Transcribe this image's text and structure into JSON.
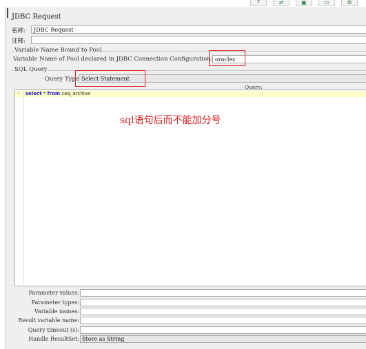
{
  "title": "JDBC Request",
  "name": {
    "label": "名称:",
    "value": "JDBC Request"
  },
  "comments": {
    "label": "注释:",
    "value": ""
  },
  "pool_group": {
    "legend": "Variable Name Bound to Pool",
    "pool_label": "Variable Name of Pool declared in JDBC Connection Configuration:",
    "pool_value": "oraclez"
  },
  "sql_group": {
    "legend": "SQL Query",
    "query_type_label": "Query Type:",
    "query_type_value": "Select Statement",
    "query_header": "Query:",
    "line_number": "1",
    "code_keyword_select": "select",
    "code_star": "*",
    "code_keyword_from": "from",
    "code_table": "ceq_archive"
  },
  "annotation": "sql语句后而不能加分号",
  "params": {
    "parameter_values_label": "Parameter values:",
    "parameter_types_label": "Parameter types:",
    "variable_names_label": "Variable names:",
    "result_variable_label": "Result variable name:",
    "query_timeout_label": "Query timeout (s):",
    "handle_resultset_label": "Handle ResultSet:",
    "handle_resultset_value": "Store as String"
  },
  "toolbar": {
    "icons": [
      "toolbar-icon-1",
      "toolbar-icon-2",
      "toolbar-icon-3",
      "toolbar-icon-4",
      "toolbar-icon-5"
    ],
    "accent_color": "#2a7a3a"
  },
  "colors": {
    "annotation_red": "#e02020",
    "keyword_blue": "#1818c8",
    "line_highlight": "#ffffc8",
    "panel_bg": "#efefef"
  }
}
